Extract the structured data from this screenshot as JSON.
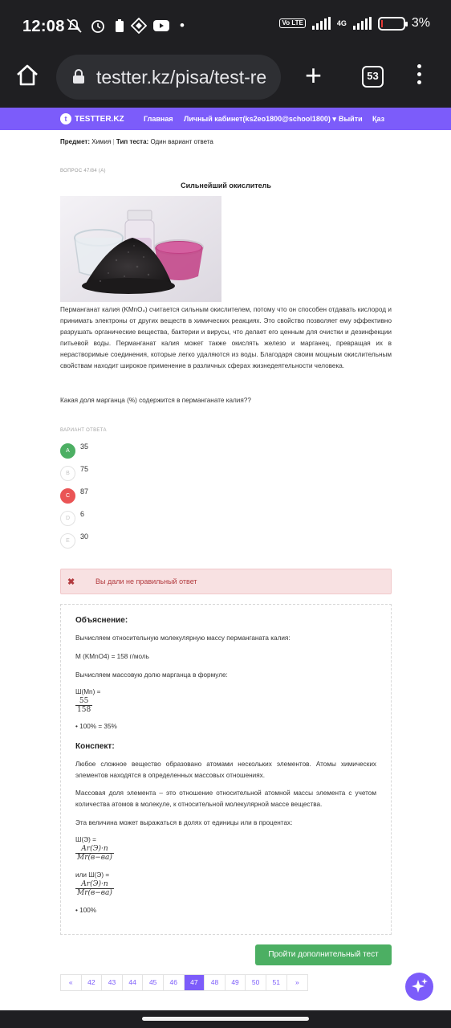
{
  "status_bar": {
    "time": "12:08",
    "network_label": "4G",
    "volte_label": "Vo LTE",
    "battery_percent": "3%",
    "icons": [
      "mute-icon",
      "alarm-icon",
      "battery-saver-icon",
      "notification-icon",
      "youtube-icon",
      "dot-icon"
    ]
  },
  "browser": {
    "url": "testter.kz/pisa/test-re",
    "tab_count": "53"
  },
  "site_nav": {
    "logo": "TESTTER.KZ",
    "home": "Главная",
    "cabinet": "Личный кабинет(ks2eo1800@school1800)",
    "logout": "Выйти",
    "lang": "Қаз"
  },
  "meta": {
    "subject_label": "Предмет:",
    "subject": "Химия",
    "type_label": "Тип теста:",
    "type": "Один вариант ответа"
  },
  "question": {
    "number_label": "ВОПРОС 47/84 (А)",
    "title": "Сильнейший окислитель",
    "text": "Перманганат калия (KMnO₄) считается сильным окислителем, потому что он способен отдавать кислород и принимать электроны от других веществ в химических реакциях. Это свойство позволяет ему эффективно разрушать органические вещества, бактерии и вирусы, что делает его ценным для очистки и дезинфекции питьевой воды. Перманганат калия может также окислять железо и марганец, превращая их в нерастворимые соединения, которые легко удаляются из воды. Благодаря своим мощным окислительным свойствам находит широкое применение в различных сферах жизнедеятельности человека.",
    "ask": "Какая доля марганца (%) содержится в перманганате калия??"
  },
  "answers": {
    "label": "ВАРИАНТ ОТВЕТА",
    "options": [
      {
        "letter": "A",
        "value": "35",
        "state": "correct"
      },
      {
        "letter": "B",
        "value": "75",
        "state": "none"
      },
      {
        "letter": "C",
        "value": "87",
        "state": "wrong"
      },
      {
        "letter": "D",
        "value": "6",
        "state": "none"
      },
      {
        "letter": "E",
        "value": "30",
        "state": "none"
      }
    ]
  },
  "alert": {
    "text": "Вы дали не правильный ответ"
  },
  "explanation": {
    "title": "Объяснение:",
    "line1": "Вычисляем относительную молекулярную массу перманганата калия:",
    "line2": "M (KMnO4) = 158 г/моль",
    "line3": "Вычисляем массовую долю марганца в формуле:",
    "w_mn": "Ш(Mn) =",
    "frac_num": "55",
    "frac_den": "158",
    "result": "• 100% = 35%",
    "summary_title": "Конспект:",
    "p1": "Любое сложное вещество образовано атомами нескольких элементов. Атомы химических элементов находятся в определенных массовых отношениях.",
    "p2": "Массовая доля элемента – это отношение относительной атомной массы элемента с учетом количества атомов в молекуле, к относительной молекулярной массе вещества.",
    "p3": "Эта величина может выражаться в долях от единицы или в процентах:",
    "w_e": "Ш(Э) =",
    "f1_num": "Ar(Э)·n",
    "f1_den": "Mr(в−ва)",
    "or_label": "или Ш(Э) =",
    "f2_num": "Ar(Э)·n",
    "f2_den": "Mr(в−ва)",
    "tail": "• 100%"
  },
  "more_button": "Пройти дополнительный тест",
  "pagination": {
    "prev": "«",
    "pages": [
      "42",
      "43",
      "44",
      "45",
      "46",
      "47",
      "48",
      "49",
      "50",
      "51"
    ],
    "active": "47",
    "next": "»"
  },
  "colors": {
    "accent": "#7c5cfa",
    "correct": "#4caf63",
    "wrong": "#ea5455",
    "alert_bg": "#f8e1e2"
  }
}
